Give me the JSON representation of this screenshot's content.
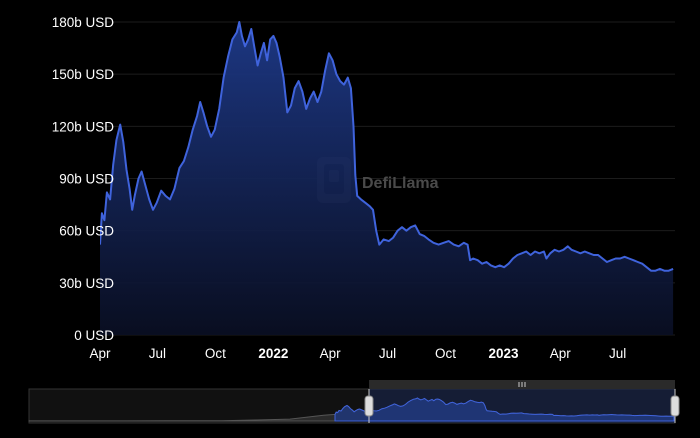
{
  "colors": {
    "background": "#000000",
    "line": "#3f63dc",
    "area_top": "#1e3a8a",
    "area_bottom": "#0a0f24",
    "grid": "#1c1c1c",
    "text": "#ffffff",
    "watermark": "#4a4a4a",
    "slider_bg": "#1a1a1a",
    "slider_handle": "#d0d0d0"
  },
  "watermark": {
    "text": "DefiLlama",
    "icon": "defillama-logo-icon"
  },
  "chart_data": {
    "type": "area",
    "grid": true,
    "legend": "none",
    "x_ticks": [
      {
        "label": "Apr",
        "date": "2021-04-01",
        "bold": false
      },
      {
        "label": "Jul",
        "date": "2021-07-01",
        "bold": false
      },
      {
        "label": "Oct",
        "date": "2021-10-01",
        "bold": false
      },
      {
        "label": "2022",
        "date": "2022-01-01",
        "bold": true
      },
      {
        "label": "Apr",
        "date": "2022-04-01",
        "bold": false
      },
      {
        "label": "Jul",
        "date": "2022-07-01",
        "bold": false
      },
      {
        "label": "Oct",
        "date": "2022-10-01",
        "bold": false
      },
      {
        "label": "2023",
        "date": "2023-01-01",
        "bold": true
      },
      {
        "label": "Apr",
        "date": "2023-04-01",
        "bold": false
      },
      {
        "label": "Jul",
        "date": "2023-07-01",
        "bold": false
      }
    ],
    "y_ticks": [
      {
        "label": "0 USD",
        "value": 0
      },
      {
        "label": "30b USD",
        "value": 30
      },
      {
        "label": "60b USD",
        "value": 60
      },
      {
        "label": "90b USD",
        "value": 90
      },
      {
        "label": "120b USD",
        "value": 120
      },
      {
        "label": "150b USD",
        "value": 150
      },
      {
        "label": "180b USD",
        "value": 180
      }
    ],
    "xlim": [
      "2021-04-01",
      "2023-09-30"
    ],
    "ylim": [
      0,
      185
    ],
    "y_unit": "billion USD",
    "series": [
      {
        "values": [
          [
            "2021-04-01",
            52
          ],
          [
            "2021-04-04",
            70
          ],
          [
            "2021-04-08",
            66
          ],
          [
            "2021-04-12",
            82
          ],
          [
            "2021-04-17",
            78
          ],
          [
            "2021-04-22",
            98
          ],
          [
            "2021-04-27",
            112
          ],
          [
            "2021-05-03",
            121
          ],
          [
            "2021-05-08",
            111
          ],
          [
            "2021-05-13",
            95
          ],
          [
            "2021-05-18",
            84
          ],
          [
            "2021-05-22",
            72
          ],
          [
            "2021-05-26",
            80
          ],
          [
            "2021-06-01",
            90
          ],
          [
            "2021-06-06",
            94
          ],
          [
            "2021-06-12",
            86
          ],
          [
            "2021-06-18",
            78
          ],
          [
            "2021-06-24",
            72
          ],
          [
            "2021-06-30",
            76
          ],
          [
            "2021-07-07",
            83
          ],
          [
            "2021-07-14",
            80
          ],
          [
            "2021-07-21",
            78
          ],
          [
            "2021-07-28",
            84
          ],
          [
            "2021-08-05",
            96
          ],
          [
            "2021-08-12",
            100
          ],
          [
            "2021-08-19",
            108
          ],
          [
            "2021-08-26",
            118
          ],
          [
            "2021-09-02",
            126
          ],
          [
            "2021-09-07",
            134
          ],
          [
            "2021-09-12",
            128
          ],
          [
            "2021-09-18",
            120
          ],
          [
            "2021-09-24",
            114
          ],
          [
            "2021-09-30",
            118
          ],
          [
            "2021-10-07",
            130
          ],
          [
            "2021-10-14",
            148
          ],
          [
            "2021-10-21",
            160
          ],
          [
            "2021-10-28",
            170
          ],
          [
            "2021-11-04",
            174
          ],
          [
            "2021-11-08",
            180
          ],
          [
            "2021-11-12",
            172
          ],
          [
            "2021-11-17",
            166
          ],
          [
            "2021-11-22",
            170
          ],
          [
            "2021-11-27",
            176
          ],
          [
            "2021-12-02",
            165
          ],
          [
            "2021-12-07",
            155
          ],
          [
            "2021-12-12",
            162
          ],
          [
            "2021-12-17",
            168
          ],
          [
            "2021-12-22",
            158
          ],
          [
            "2021-12-27",
            170
          ],
          [
            "2022-01-01",
            172
          ],
          [
            "2022-01-06",
            168
          ],
          [
            "2022-01-11",
            160
          ],
          [
            "2022-01-17",
            148
          ],
          [
            "2022-01-23",
            128
          ],
          [
            "2022-01-29",
            132
          ],
          [
            "2022-02-04",
            142
          ],
          [
            "2022-02-10",
            146
          ],
          [
            "2022-02-16",
            140
          ],
          [
            "2022-02-22",
            130
          ],
          [
            "2022-02-28",
            136
          ],
          [
            "2022-03-06",
            140
          ],
          [
            "2022-03-12",
            134
          ],
          [
            "2022-03-18",
            140
          ],
          [
            "2022-03-24",
            152
          ],
          [
            "2022-03-30",
            162
          ],
          [
            "2022-04-05",
            158
          ],
          [
            "2022-04-11",
            150
          ],
          [
            "2022-04-17",
            146
          ],
          [
            "2022-04-23",
            144
          ],
          [
            "2022-04-29",
            148
          ],
          [
            "2022-05-04",
            142
          ],
          [
            "2022-05-08",
            120
          ],
          [
            "2022-05-11",
            92
          ],
          [
            "2022-05-14",
            80
          ],
          [
            "2022-05-20",
            78
          ],
          [
            "2022-05-27",
            76
          ],
          [
            "2022-06-03",
            74
          ],
          [
            "2022-06-08",
            72
          ],
          [
            "2022-06-13",
            60
          ],
          [
            "2022-06-18",
            52
          ],
          [
            "2022-06-25",
            55
          ],
          [
            "2022-07-03",
            54
          ],
          [
            "2022-07-10",
            56
          ],
          [
            "2022-07-17",
            60
          ],
          [
            "2022-07-24",
            62
          ],
          [
            "2022-07-31",
            60
          ],
          [
            "2022-08-07",
            62
          ],
          [
            "2022-08-14",
            63
          ],
          [
            "2022-08-21",
            58
          ],
          [
            "2022-08-28",
            57
          ],
          [
            "2022-09-04",
            55
          ],
          [
            "2022-09-12",
            53
          ],
          [
            "2022-09-20",
            52
          ],
          [
            "2022-09-28",
            53
          ],
          [
            "2022-10-06",
            54
          ],
          [
            "2022-10-14",
            52
          ],
          [
            "2022-10-22",
            51
          ],
          [
            "2022-10-30",
            53
          ],
          [
            "2022-11-05",
            52
          ],
          [
            "2022-11-09",
            43
          ],
          [
            "2022-11-14",
            44
          ],
          [
            "2022-11-21",
            43
          ],
          [
            "2022-11-28",
            41
          ],
          [
            "2022-12-05",
            42
          ],
          [
            "2022-12-12",
            40
          ],
          [
            "2022-12-19",
            39
          ],
          [
            "2022-12-26",
            40
          ],
          [
            "2023-01-02",
            39
          ],
          [
            "2023-01-09",
            41
          ],
          [
            "2023-01-16",
            44
          ],
          [
            "2023-01-23",
            46
          ],
          [
            "2023-01-30",
            47
          ],
          [
            "2023-02-06",
            48
          ],
          [
            "2023-02-13",
            46
          ],
          [
            "2023-02-20",
            48
          ],
          [
            "2023-02-27",
            47
          ],
          [
            "2023-03-06",
            48
          ],
          [
            "2023-03-10",
            44
          ],
          [
            "2023-03-16",
            47
          ],
          [
            "2023-03-23",
            49
          ],
          [
            "2023-03-30",
            48
          ],
          [
            "2023-04-06",
            49
          ],
          [
            "2023-04-13",
            51
          ],
          [
            "2023-04-19",
            49
          ],
          [
            "2023-04-26",
            48
          ],
          [
            "2023-05-03",
            47
          ],
          [
            "2023-05-10",
            48
          ],
          [
            "2023-05-17",
            47
          ],
          [
            "2023-05-24",
            46
          ],
          [
            "2023-05-31",
            46
          ],
          [
            "2023-06-07",
            44
          ],
          [
            "2023-06-14",
            42
          ],
          [
            "2023-06-21",
            43
          ],
          [
            "2023-06-28",
            44
          ],
          [
            "2023-07-05",
            44
          ],
          [
            "2023-07-12",
            45
          ],
          [
            "2023-07-19",
            44
          ],
          [
            "2023-07-26",
            43
          ],
          [
            "2023-08-02",
            42
          ],
          [
            "2023-08-09",
            41
          ],
          [
            "2023-08-16",
            39
          ],
          [
            "2023-08-23",
            37
          ],
          [
            "2023-08-30",
            37
          ],
          [
            "2023-09-06",
            38
          ],
          [
            "2023-09-13",
            37
          ],
          [
            "2023-09-20",
            37
          ],
          [
            "2023-09-27",
            38
          ]
        ]
      }
    ],
    "data_zoom": {
      "overview_start": "2019-01-01",
      "overview_end": "2023-09-30",
      "selected_start": "2021-04-01",
      "selected_end": "2023-09-30"
    }
  }
}
